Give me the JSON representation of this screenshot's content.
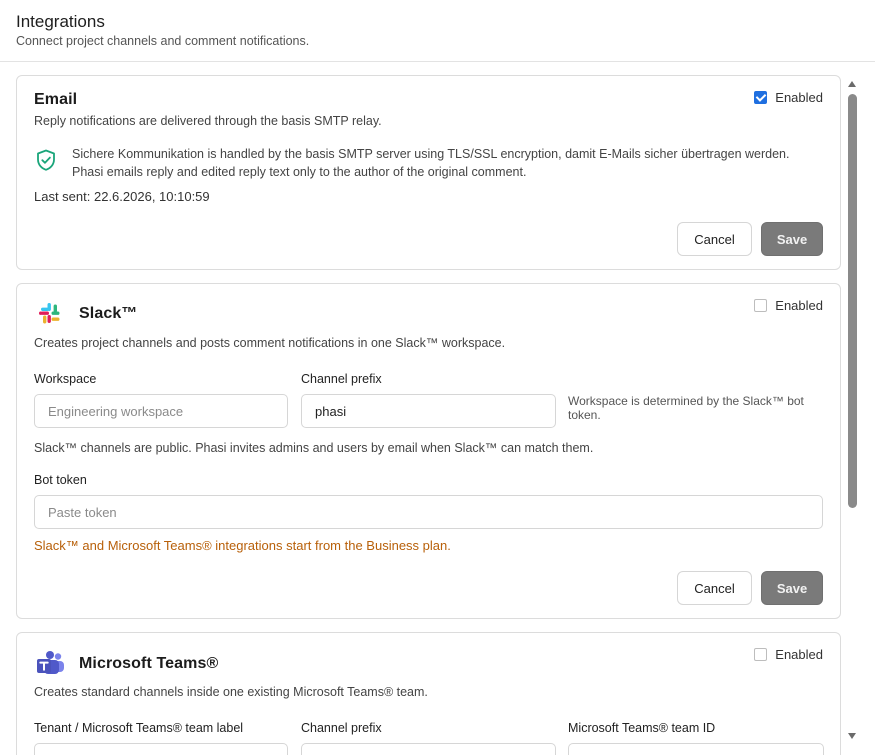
{
  "header": {
    "title": "Integrations",
    "subtitle": "Connect project channels and comment notifications."
  },
  "email": {
    "title": "Email",
    "description": "Reply notifications are delivered through the basis SMTP relay.",
    "enabled_label": "Enabled",
    "enabled": true,
    "info_icon": "shield-check-icon",
    "info_line1": "Sichere Kommunikation is handled by the basis SMTP server using TLS/SSL encryption, damit E-Mails sicher übertragen werden.",
    "info_line2": "Phasi emails reply and edited reply text only to the author of the original comment.",
    "last_sent": "Last sent: 22.6.2026, 10:10:59",
    "cancel_label": "Cancel",
    "save_label": "Save"
  },
  "slack": {
    "title": "Slack™",
    "logo_icon": "slack-logo-icon",
    "description": "Creates project channels and posts comment notifications in one Slack™ workspace.",
    "enabled_label": "Enabled",
    "enabled": false,
    "workspace_label": "Workspace",
    "workspace_placeholder": "Engineering workspace",
    "workspace_value": "",
    "channel_prefix_label": "Channel prefix",
    "channel_prefix_value": "phasi",
    "workspace_hint": "Workspace is determined by the Slack™ bot token.",
    "channels_note": "Slack™ channels are public. Phasi invites admins and users by email when Slack™ can match them.",
    "bot_token_label": "Bot token",
    "bot_token_placeholder": "Paste token",
    "plan_warning": "Slack™ and Microsoft Teams® integrations start from the Business plan.",
    "cancel_label": "Cancel",
    "save_label": "Save"
  },
  "teams": {
    "title": "Microsoft Teams®",
    "logo_icon": "teams-logo-icon",
    "description": "Creates standard channels inside one existing Microsoft Teams® team.",
    "enabled_label": "Enabled",
    "enabled": false,
    "tenant_label": "Tenant / Microsoft Teams® team label",
    "channel_prefix_label": "Channel prefix",
    "team_id_label": "Microsoft Teams® team ID"
  },
  "colors": {
    "accent": "#1f6fe0",
    "warning": "#b8600a",
    "save_button": "#7a7a7a",
    "shield": "#1aa57a"
  }
}
